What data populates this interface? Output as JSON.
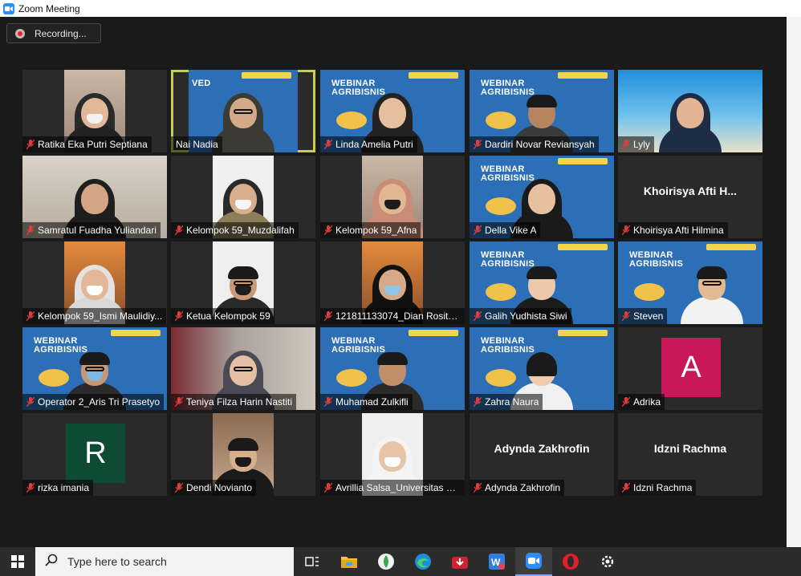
{
  "window": {
    "title": "Zoom Meeting"
  },
  "recording": {
    "label": "Recording..."
  },
  "participants": [
    {
      "name": "Ratika Eka Putri Septiana"
    },
    {
      "name": "Nai Nadia"
    },
    {
      "name": "Linda Amelia Putri"
    },
    {
      "name": "Dardiri Novar Reviansyah"
    },
    {
      "name": "Lyly"
    },
    {
      "name": "Samratul Fuadha Yuliandari"
    },
    {
      "name": "Kelompok 59_Muzdalifah"
    },
    {
      "name": "Kelompok 59_Afna"
    },
    {
      "name": "Della Vike A"
    },
    {
      "name": "Khoirisya Afti Hilmina",
      "display": "Khoirisya Afti H..."
    },
    {
      "name": "Kelompok 59_Ismi Maulidiy..."
    },
    {
      "name": "Ketua Kelompok 59"
    },
    {
      "name": "121811133074_Dian Rosita..."
    },
    {
      "name": "Galih Yudhista Siwi"
    },
    {
      "name": "Steven"
    },
    {
      "name": "Operator 2_Aris Tri Prasetyo"
    },
    {
      "name": "Teniya Filza Harin Nastiti"
    },
    {
      "name": "Muhamad Zulkifli"
    },
    {
      "name": "Zahra Naura"
    },
    {
      "name": "Adrika",
      "initial": "A",
      "color": "#c8185a"
    },
    {
      "name": "rizka imania",
      "initial": "R",
      "color": "#0e4b35"
    },
    {
      "name": "Dendi Novianto"
    },
    {
      "name": "Avrillia Salsa_Universitas dr..."
    },
    {
      "name": "Adynda Zakhrofin",
      "display": "Adynda Zakhrofin"
    },
    {
      "name": "Idzni Rachma",
      "display": "Idzni Rachma"
    }
  ],
  "webinar": {
    "line1": "WEBINAR",
    "line2": "AGRIBISNIS",
    "partial": "VED"
  },
  "taskbar": {
    "search_placeholder": "Type here to search",
    "icons": [
      "windows-icon",
      "task-view-icon",
      "file-explorer-icon",
      "app-green-icon",
      "edge-icon",
      "download-icon",
      "app-blue-icon",
      "zoom-icon",
      "opera-icon",
      "settings-icon"
    ]
  },
  "colors": {
    "active_speaker": "#c8d04a",
    "zoom_blue": "#2d8cff",
    "webinar_bg": "#2c6fb7"
  }
}
